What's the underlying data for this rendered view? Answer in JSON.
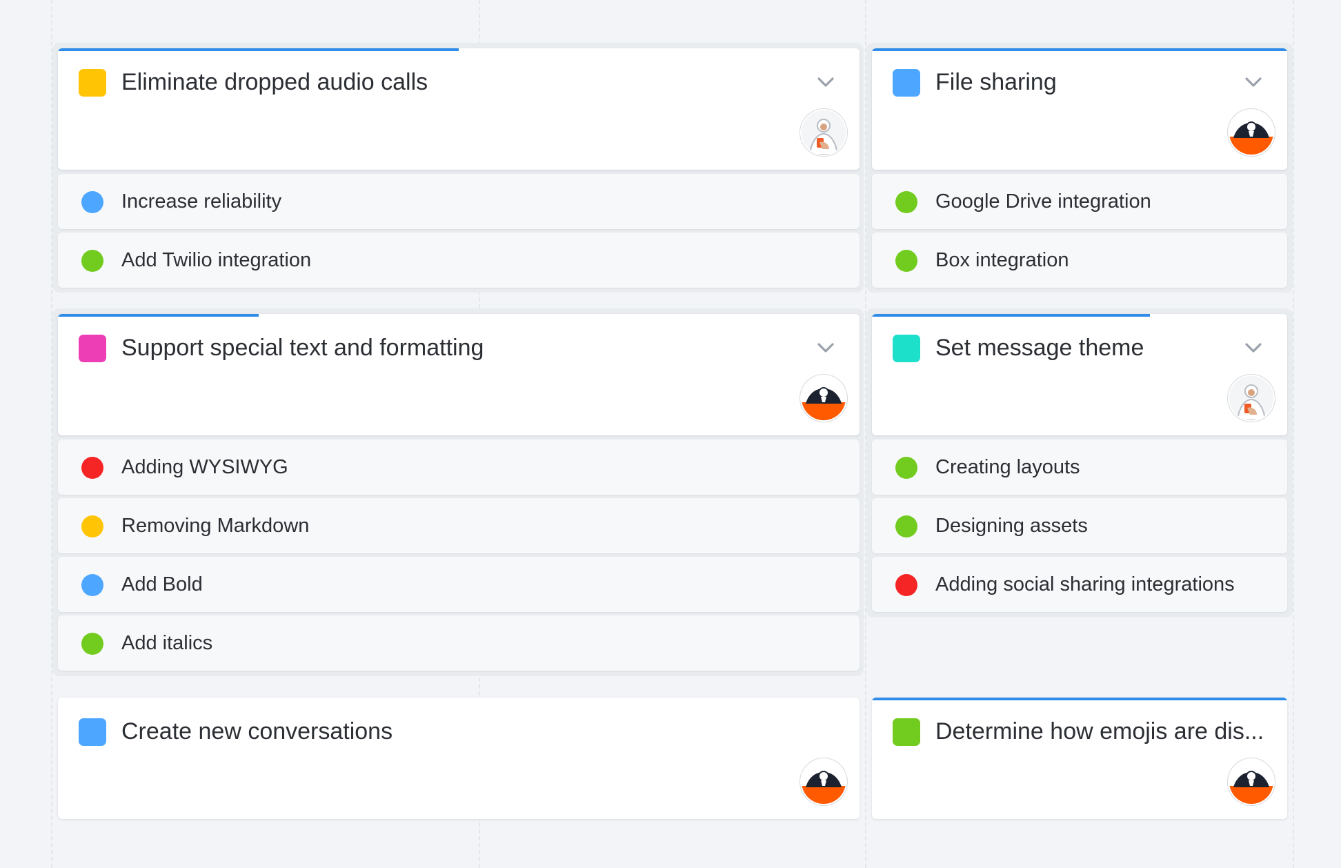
{
  "colors": {
    "progress": "#2f8ce8",
    "yellow": "#ffc404",
    "blue": "#4da6ff",
    "pink": "#ee3eb5",
    "teal": "#1de0cb",
    "green": "#72cb1f",
    "red": "#f52525"
  },
  "board": {
    "groups": [
      {
        "title": "Eliminate dropped audio calls",
        "swatch_color": "#ffc404",
        "progress": 0.5,
        "owner": "avatar-illustrated-person",
        "items": [
          {
            "label": "Increase reliability",
            "status_color": "#4da6ff"
          },
          {
            "label": "Add Twilio integration",
            "status_color": "#72cb1f"
          }
        ]
      },
      {
        "title": "File sharing",
        "swatch_color": "#4da6ff",
        "progress": 1.0,
        "owner": "avatar-woman-orange",
        "items": [
          {
            "label": "Google Drive integration",
            "status_color": "#72cb1f"
          },
          {
            "label": "Box integration",
            "status_color": "#72cb1f"
          }
        ]
      },
      {
        "title": "Support special text and formatting",
        "swatch_color": "#ee3eb5",
        "progress": 0.25,
        "owner": "avatar-woman-orange",
        "items": [
          {
            "label": "Adding WYSIWYG",
            "status_color": "#f52525"
          },
          {
            "label": "Removing Markdown",
            "status_color": "#ffc404"
          },
          {
            "label": "Add Bold",
            "status_color": "#4da6ff"
          },
          {
            "label": "Add italics",
            "status_color": "#72cb1f"
          }
        ]
      },
      {
        "title": "Set message theme",
        "swatch_color": "#1de0cb",
        "progress": 0.67,
        "owner": "avatar-illustrated-person",
        "items": [
          {
            "label": "Creating layouts",
            "status_color": "#72cb1f"
          },
          {
            "label": "Designing assets",
            "status_color": "#72cb1f"
          },
          {
            "label": "Adding social sharing integrations",
            "status_color": "#f52525"
          }
        ]
      },
      {
        "title": "Create new conversations",
        "swatch_color": "#4da6ff",
        "progress": 0,
        "owner": "avatar-woman-orange",
        "items": []
      },
      {
        "title": "Determine how emojis are dis...",
        "swatch_color": "#72cb1f",
        "progress": 1.0,
        "owner": "avatar-woman-orange",
        "items": []
      }
    ]
  }
}
